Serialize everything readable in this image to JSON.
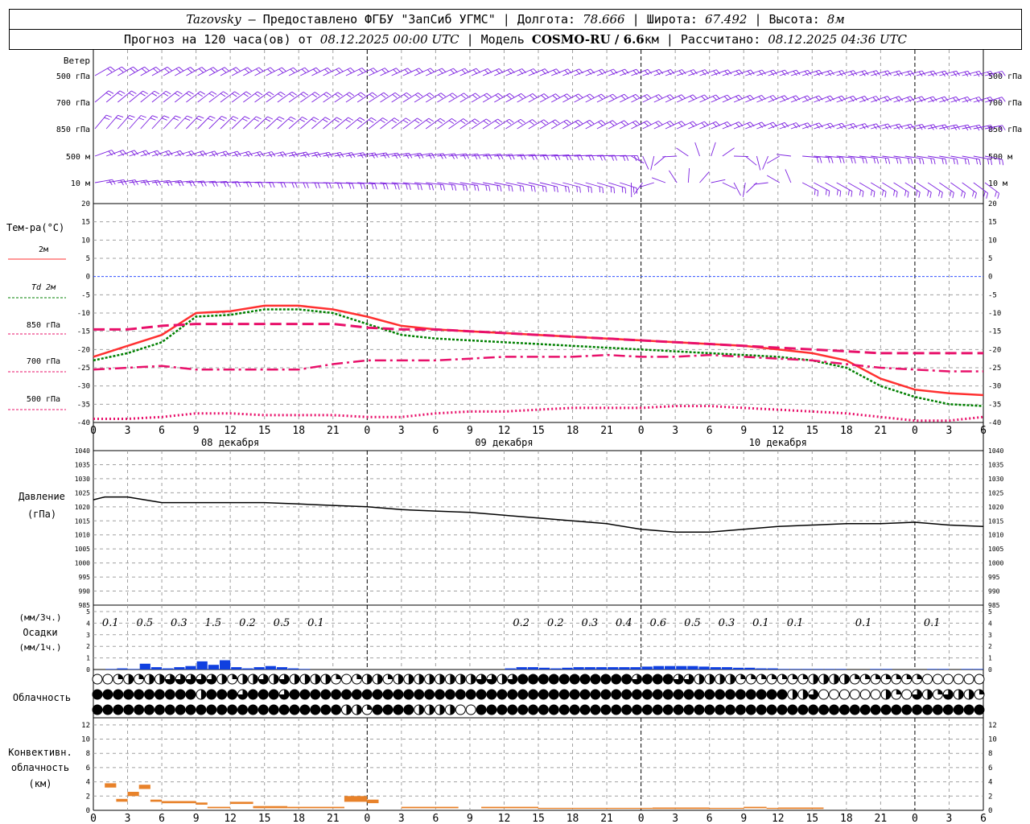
{
  "header": {
    "station": "Tazovsky",
    "provider": " — Предоставлено ФГБУ \"ЗапСиб УГМС\" | Долгота: ",
    "lon": "78.666",
    "lat_label": " | Широта: ",
    "lat": "67.492",
    "alt_label": " | Высота: ",
    "alt": "8м",
    "forecast_label": "Прогноз на 120 часа(ов) от ",
    "forecast_start": "08.12.2025 00:00 UTC",
    "model_label": " | Модель ",
    "model": "COSMO-RU / 6.6",
    "model_unit": "км | Рассчитано: ",
    "computed": "08.12.2025 04:36 UTC"
  },
  "colors": {
    "temp2m": "#ff3030",
    "td2m": "#008000",
    "t850": "#e8106a",
    "t700": "#e8106a",
    "t500": "#e8106a",
    "zero_line": "#3050ff",
    "wind": "#7b1fe0",
    "pressure": "#000000",
    "precip": "#1040e0",
    "conv": "#e8822a",
    "grid": "#a0a0a0"
  },
  "axis": {
    "hour_ticks": [
      "0",
      "3",
      "6",
      "9",
      "12",
      "15",
      "18",
      "21",
      "0",
      "3",
      "6",
      "9",
      "12",
      "15",
      "18",
      "21",
      "0",
      "3",
      "6",
      "9",
      "12",
      "15",
      "18",
      "21",
      "0",
      "3",
      "6"
    ],
    "day_labels": [
      "08 декабря",
      "09 декабря",
      "10 декабря"
    ]
  },
  "chart_data": [
    {
      "type": "barbs",
      "title": "Ветер",
      "levels": [
        "500 гПа",
        "700 гПа",
        "850 гПа",
        "500 м",
        "10  м"
      ]
    },
    {
      "type": "line",
      "ylabel": "Тем-ра(°C)",
      "ylim": [
        -40,
        20
      ],
      "yticks": [
        20,
        15,
        10,
        5,
        0,
        -5,
        -10,
        -15,
        -20,
        -25,
        -30,
        -35,
        -40
      ],
      "x_hours": [
        0,
        3,
        6,
        9,
        12,
        15,
        18,
        21,
        24,
        27,
        30,
        33,
        36,
        39,
        42,
        45,
        48,
        51,
        54,
        57,
        60,
        63,
        66,
        69,
        72,
        75,
        78
      ],
      "series": [
        {
          "name": "2м",
          "values": [
            -22,
            -19,
            -16,
            -10,
            -9.5,
            -8,
            -8,
            -9,
            -11,
            -13.5,
            -14.5,
            -15,
            -15.5,
            -16,
            -16.5,
            -17,
            -17.5,
            -18,
            -18.5,
            -19,
            -20,
            -21,
            -23,
            -28,
            -31,
            -32,
            -32.5
          ]
        },
        {
          "name": "Td 2м",
          "values": [
            -23,
            -21,
            -18,
            -11,
            -10.5,
            -9,
            -9,
            -10,
            -13,
            -16,
            -17,
            -17.5,
            -18,
            -18.5,
            -19,
            -19.5,
            -20,
            -20.5,
            -21,
            -21.5,
            -22,
            -23,
            -25,
            -30,
            -33,
            -35,
            -35.5
          ]
        },
        {
          "name": "850 гПа",
          "values": [
            -14.5,
            -14.5,
            -13.5,
            -13,
            -13,
            -13,
            -13,
            -13,
            -14,
            -14.5,
            -14.5,
            -15,
            -15.5,
            -16,
            -16.5,
            -17,
            -17.5,
            -18,
            -18.5,
            -19,
            -19.5,
            -20,
            -20.5,
            -21,
            -21,
            -21,
            -21
          ]
        },
        {
          "name": "700 гПа",
          "values": [
            -25.5,
            -25,
            -24.5,
            -25.5,
            -25.5,
            -25.5,
            -25.5,
            -24,
            -23,
            -23,
            -23,
            -22.5,
            -22,
            -22,
            -22,
            -21.5,
            -22,
            -22,
            -21.5,
            -22,
            -22.5,
            -23,
            -24,
            -25,
            -25.5,
            -26,
            -26
          ]
        },
        {
          "name": "500 гПа",
          "values": [
            -39,
            -39,
            -38.5,
            -37.5,
            -37.5,
            -38,
            -38,
            -38,
            -38.5,
            -38.5,
            -37.5,
            -37,
            -37,
            -36.5,
            -36,
            -36,
            -36,
            -35.5,
            -35.5,
            -36,
            -36.5,
            -37,
            -37.5,
            -38.5,
            -39.5,
            -39.5,
            -38.5
          ]
        }
      ]
    },
    {
      "type": "line",
      "ylabel": "Давление",
      "yunit": "(гПа)",
      "ylim": [
        985,
        1040
      ],
      "yticks": [
        1040,
        1035,
        1030,
        1025,
        1020,
        1015,
        1010,
        1005,
        1000,
        995,
        990,
        985
      ],
      "x_hours": [
        0,
        1,
        3,
        6,
        9,
        12,
        15,
        18,
        21,
        24,
        27,
        30,
        33,
        36,
        39,
        42,
        45,
        48,
        51,
        54,
        57,
        60,
        63,
        66,
        69,
        72,
        75,
        78
      ],
      "series": [
        {
          "name": "",
          "values": [
            1022.5,
            1023.5,
            1023.5,
            1021.5,
            1021.5,
            1021.5,
            1021.5,
            1021,
            1020.5,
            1020,
            1019,
            1018.5,
            1018,
            1017,
            1016,
            1015,
            1014,
            1012,
            1011,
            1011,
            1012,
            1013,
            1013.5,
            1014,
            1014,
            1014.5,
            1013.5,
            1013
          ]
        }
      ]
    },
    {
      "type": "bar",
      "ylabel": "Осадки",
      "units": [
        "(мм/3ч.)",
        "(мм/1ч.)"
      ],
      "ylim": [
        0,
        5
      ],
      "yticks": [
        5,
        4,
        3,
        2,
        1,
        0
      ],
      "totals_3h": [
        {
          "h": 1.5,
          "label": "0.1"
        },
        {
          "h": 4.5,
          "label": "0.5"
        },
        {
          "h": 7.5,
          "label": "0.3"
        },
        {
          "h": 10.5,
          "label": "1.5"
        },
        {
          "h": 13.5,
          "label": "0.2"
        },
        {
          "h": 16.5,
          "label": "0.5"
        },
        {
          "h": 19.5,
          "label": "0.1"
        },
        {
          "h": 37.5,
          "label": "0.2"
        },
        {
          "h": 40.5,
          "label": "0.2"
        },
        {
          "h": 43.5,
          "label": "0.3"
        },
        {
          "h": 46.5,
          "label": "0.4"
        },
        {
          "h": 49.5,
          "label": "0.6"
        },
        {
          "h": 52.5,
          "label": "0.5"
        },
        {
          "h": 55.5,
          "label": "0.3"
        },
        {
          "h": 58.5,
          "label": "0.1"
        },
        {
          "h": 61.5,
          "label": "0.1"
        },
        {
          "h": 67.5,
          "label": "0.1"
        },
        {
          "h": 73.5,
          "label": "0.1"
        }
      ],
      "hourly": [
        0,
        0.05,
        0.1,
        0.05,
        0.5,
        0.2,
        0.1,
        0.2,
        0.3,
        0.7,
        0.4,
        0.8,
        0.2,
        0.1,
        0.2,
        0.3,
        0.2,
        0.1,
        0.05,
        0,
        0,
        0,
        0,
        0,
        0,
        0,
        0,
        0,
        0,
        0,
        0,
        0,
        0,
        0,
        0,
        0,
        0.1,
        0.2,
        0.2,
        0.15,
        0.1,
        0.15,
        0.2,
        0.2,
        0.2,
        0.2,
        0.2,
        0.2,
        0.25,
        0.3,
        0.3,
        0.3,
        0.3,
        0.25,
        0.2,
        0.2,
        0.15,
        0.15,
        0.1,
        0.1,
        0.05,
        0.05,
        0.05,
        0.05,
        0.05,
        0.05,
        0,
        0,
        0.05,
        0.05,
        0,
        0,
        0,
        0.05,
        0.05,
        0,
        0.05,
        0.05,
        0
      ]
    },
    {
      "type": "symbols",
      "ylabel": "Облачность",
      "rows": [
        [
          0,
          0,
          0.25,
          0.5,
          0.25,
          0.5,
          0.5,
          0.75,
          0.75,
          0.75,
          0.75,
          0.75,
          0.5,
          0.25,
          0.5,
          0.5,
          0.75,
          0.5,
          0.75,
          0.5,
          0.5,
          0.5,
          0.5,
          0.25,
          0,
          0.25,
          0.5,
          0.5,
          0.25,
          0.5,
          0.5,
          0.5,
          0.5,
          0.5,
          0.5,
          0.5,
          0.5,
          0.75,
          0.75,
          0.5,
          0.75,
          1,
          1,
          1,
          1,
          1,
          1,
          1,
          1,
          1,
          1,
          1,
          0.75,
          1,
          1,
          1,
          0.75,
          0.75,
          0.5,
          0.5,
          0.5,
          0.5,
          0.25,
          0.25,
          0.25,
          0.25,
          0.25,
          0.25,
          0.25,
          0.5,
          0.5,
          0.5,
          0.5,
          0.25,
          0.25,
          0.25,
          0.25,
          0.25,
          0.25,
          0.25,
          0,
          0,
          0,
          0,
          0,
          0
        ],
        [
          1,
          1,
          1,
          1,
          1,
          1,
          1,
          1,
          1,
          1,
          0.5,
          1,
          1,
          1,
          0.75,
          1,
          1,
          1,
          0.75,
          1,
          1,
          1,
          1,
          1,
          1,
          1,
          1,
          1,
          1,
          1,
          1,
          1,
          1,
          1,
          1,
          1,
          1,
          1,
          1,
          1,
          1,
          1,
          1,
          1,
          1,
          1,
          1,
          1,
          1,
          1,
          1,
          1,
          1,
          1,
          1,
          1,
          1,
          1,
          1,
          1,
          1,
          1,
          1,
          1,
          1,
          1,
          1,
          0.5,
          0.5,
          0.75,
          0,
          0,
          0,
          0,
          0,
          0,
          0.5,
          0.25,
          0,
          0.75,
          0.5,
          0.25,
          0.75,
          0.5,
          0.5,
          0.25
        ],
        [
          1,
          1,
          1,
          1,
          1,
          1,
          1,
          1,
          1,
          1,
          1,
          1,
          1,
          1,
          1,
          1,
          1,
          1,
          1,
          1,
          1,
          1,
          1,
          1,
          0.5,
          0.5,
          0.25,
          1,
          1,
          1,
          1,
          0.5,
          0.5,
          0.5,
          0.5,
          0,
          0,
          1,
          1,
          1,
          1,
          1,
          1,
          1,
          1,
          1,
          1,
          1,
          1,
          1,
          1,
          1,
          1,
          1,
          1,
          1,
          1,
          1,
          1,
          1,
          1,
          1,
          1,
          1,
          1,
          1,
          1,
          1,
          1,
          1,
          1,
          1,
          1,
          1,
          1,
          1,
          1,
          1,
          1,
          1,
          1,
          1,
          1,
          1,
          1,
          1
        ]
      ]
    },
    {
      "type": "bar",
      "ylabel": "Конвективн. облачность",
      "yunit": "(км)",
      "ylim": [
        0,
        13
      ],
      "yticks": [
        12,
        10,
        8,
        6,
        4,
        2,
        0
      ],
      "segments": [
        {
          "from": 1,
          "to": 2,
          "base": 3.2,
          "top": 3.8
        },
        {
          "from": 2,
          "to": 3,
          "base": 1.2,
          "top": 1.6
        },
        {
          "from": 3,
          "to": 4,
          "base": 2,
          "top": 2.6
        },
        {
          "from": 4,
          "to": 5,
          "base": 3,
          "top": 3.6
        },
        {
          "from": 5,
          "to": 6,
          "base": 1.2,
          "top": 1.5
        },
        {
          "from": 6,
          "to": 9,
          "base": 1,
          "top": 1.3
        },
        {
          "from": 9,
          "to": 10,
          "base": 0.8,
          "top": 1.1
        },
        {
          "from": 10,
          "to": 12,
          "base": 0.3,
          "top": 0.5
        },
        {
          "from": 12,
          "to": 14,
          "base": 0.9,
          "top": 1.2
        },
        {
          "from": 14,
          "to": 15,
          "base": 0.3,
          "top": 0.6
        },
        {
          "from": 15,
          "to": 17,
          "base": 0.3,
          "top": 0.6
        },
        {
          "from": 17,
          "to": 22,
          "base": 0.3,
          "top": 0.5
        },
        {
          "from": 22,
          "to": 24,
          "base": 1.2,
          "top": 2
        },
        {
          "from": 24,
          "to": 25,
          "base": 1,
          "top": 1.5
        },
        {
          "from": 27,
          "to": 32,
          "base": 0.3,
          "top": 0.5
        },
        {
          "from": 34,
          "to": 39,
          "base": 0.3,
          "top": 0.5
        },
        {
          "from": 39,
          "to": 49,
          "base": 0.2,
          "top": 0.35
        },
        {
          "from": 49,
          "to": 54,
          "base": 0.2,
          "top": 0.4
        },
        {
          "from": 54,
          "to": 57,
          "base": 0.2,
          "top": 0.35
        },
        {
          "from": 57,
          "to": 59,
          "base": 0.3,
          "top": 0.5
        },
        {
          "from": 59,
          "to": 60,
          "base": 0.2,
          "top": 0.35
        },
        {
          "from": 60,
          "to": 64,
          "base": 0.2,
          "top": 0.4
        }
      ]
    }
  ]
}
